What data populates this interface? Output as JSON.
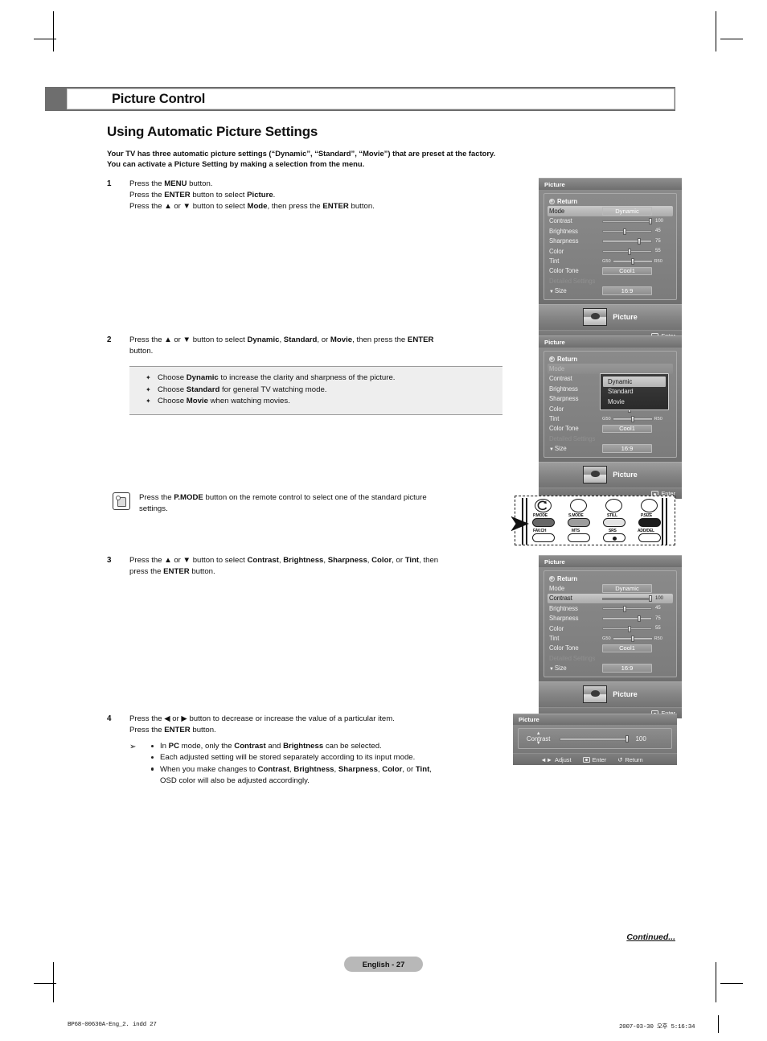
{
  "chapter": {
    "title": "Picture Control"
  },
  "heading": "Using Automatic Picture Settings",
  "intro_line1": "Your TV has three automatic picture settings (“Dynamic”, “Standard”, “Movie”) that are preset at the factory.",
  "intro_line2": "You can activate a Picture Setting by making a selection from the menu.",
  "steps": {
    "s1": {
      "num": "1",
      "l1_a": "Press the ",
      "l1_b": "MENU",
      "l1_c": " button.",
      "l2_a": "Press the ",
      "l2_b": "ENTER",
      "l2_c": " button to select ",
      "l2_d": "Picture",
      "l2_e": ".",
      "l3_a": "Press the ▲ or ▼ button to select ",
      "l3_b": "Mode",
      "l3_c": ", then press the ",
      "l3_d": "ENTER",
      "l3_e": " button."
    },
    "s2": {
      "num": "2",
      "l1_a": "Press the ▲ or ▼ button to select ",
      "l1_b": "Dynamic",
      "l1_c": ", ",
      "l1_d": "Standard",
      "l1_e": ", or ",
      "l1_f": "Movie",
      "l1_g": ", then press the ",
      "l1_h": "ENTER",
      "l2": "button."
    },
    "s3": {
      "num": "3",
      "l1_a": "Press the ▲ or ▼ button to select ",
      "l1_b": "Contrast",
      "l1_c": ", ",
      "l1_d": "Brightness",
      "l1_e": ", ",
      "l1_f": "Sharpness",
      "l1_g": ", ",
      "l1_h": "Color",
      "l1_i": ", or ",
      "l1_j": "Tint",
      "l1_k": ", then",
      "l2_a": "press the ",
      "l2_b": "ENTER",
      "l2_c": " button."
    },
    "s4": {
      "num": "4",
      "l1": "Press the ◀ or ▶ button to decrease or increase the value of a particular item.",
      "l2_a": "Press the ",
      "l2_b": "ENTER",
      "l2_c": " button."
    }
  },
  "callout": {
    "b1_a": "Choose ",
    "b1_b": "Dynamic",
    "b1_c": " to increase the clarity and sharpness of the picture.",
    "b2_a": "Choose ",
    "b2_b": "Standard",
    "b2_c": " for general TV watching mode.",
    "b3_a": "Choose ",
    "b3_b": "Movie",
    "b3_c": " when watching movies.",
    "bullet": "✦"
  },
  "hand_note": {
    "a": "Press the ",
    "b": "P.MODE",
    "c": " button on the remote control to select one of the standard picture",
    "d": "settings."
  },
  "notes": {
    "arrow": "➢",
    "n1_a": "In ",
    "n1_b": "PC",
    "n1_c": " mode, only the ",
    "n1_d": "Contrast",
    "n1_e": " and ",
    "n1_f": "Brightness",
    "n1_g": " can be selected.",
    "n2": "Each adjusted setting will be stored separately according to its input mode.",
    "n3_a": "When you make changes to ",
    "n3_b": "Contrast",
    "n3_c": ", ",
    "n3_d": "Brightness",
    "n3_e": ", ",
    "n3_f": "Sharpness",
    "n3_g": ", ",
    "n3_h": "Color",
    "n3_i": ", or ",
    "n3_j": "Tint",
    "n3_k": ",",
    "n3_l": "OSD color will also be adjusted accordingly."
  },
  "osd": {
    "title": "Picture",
    "return_label": "Return",
    "rows": {
      "mode": "Mode",
      "contrast": "Contrast",
      "brightness": "Brightness",
      "sharpness": "Sharpness",
      "color": "Color",
      "tint": "Tint",
      "color_tone": "Color Tone",
      "detailed": "Detailed Settings",
      "size": "Size"
    },
    "values": {
      "mode": "Dynamic",
      "contrast": "100",
      "brightness": "45",
      "sharpness": "75",
      "color": "55",
      "tint_left": "G50",
      "tint_right": "R50",
      "color_tone": "Cool1",
      "size": "16:9"
    },
    "slider_pct": {
      "contrast": 100,
      "brightness": 45,
      "sharpness": 75,
      "color": 55,
      "tint": 50
    },
    "foot_label": "Picture",
    "enter": "Enter",
    "mode_options": [
      "Dynamic",
      "Standard",
      "Movie"
    ],
    "mode_selected": "Dynamic"
  },
  "osd_small": {
    "title": "Picture",
    "item": "Contrast",
    "value": "100",
    "value_pct": 100,
    "adjust": "Adjust",
    "enter": "Enter",
    "return": "Return"
  },
  "remote": {
    "buttons_top": [
      "P.MODE",
      "S.MODE",
      "STILL",
      "P.SIZE"
    ],
    "buttons_bottom": [
      "FAV.CH",
      "MTS",
      "SRS",
      "ADD/DEL"
    ]
  },
  "footer": {
    "continued": "Continued...",
    "page": "English - 27",
    "print_left": "BP68-00630A-Eng_2. indd    27",
    "print_right": "2007-03-30    오후 5:16:34"
  }
}
